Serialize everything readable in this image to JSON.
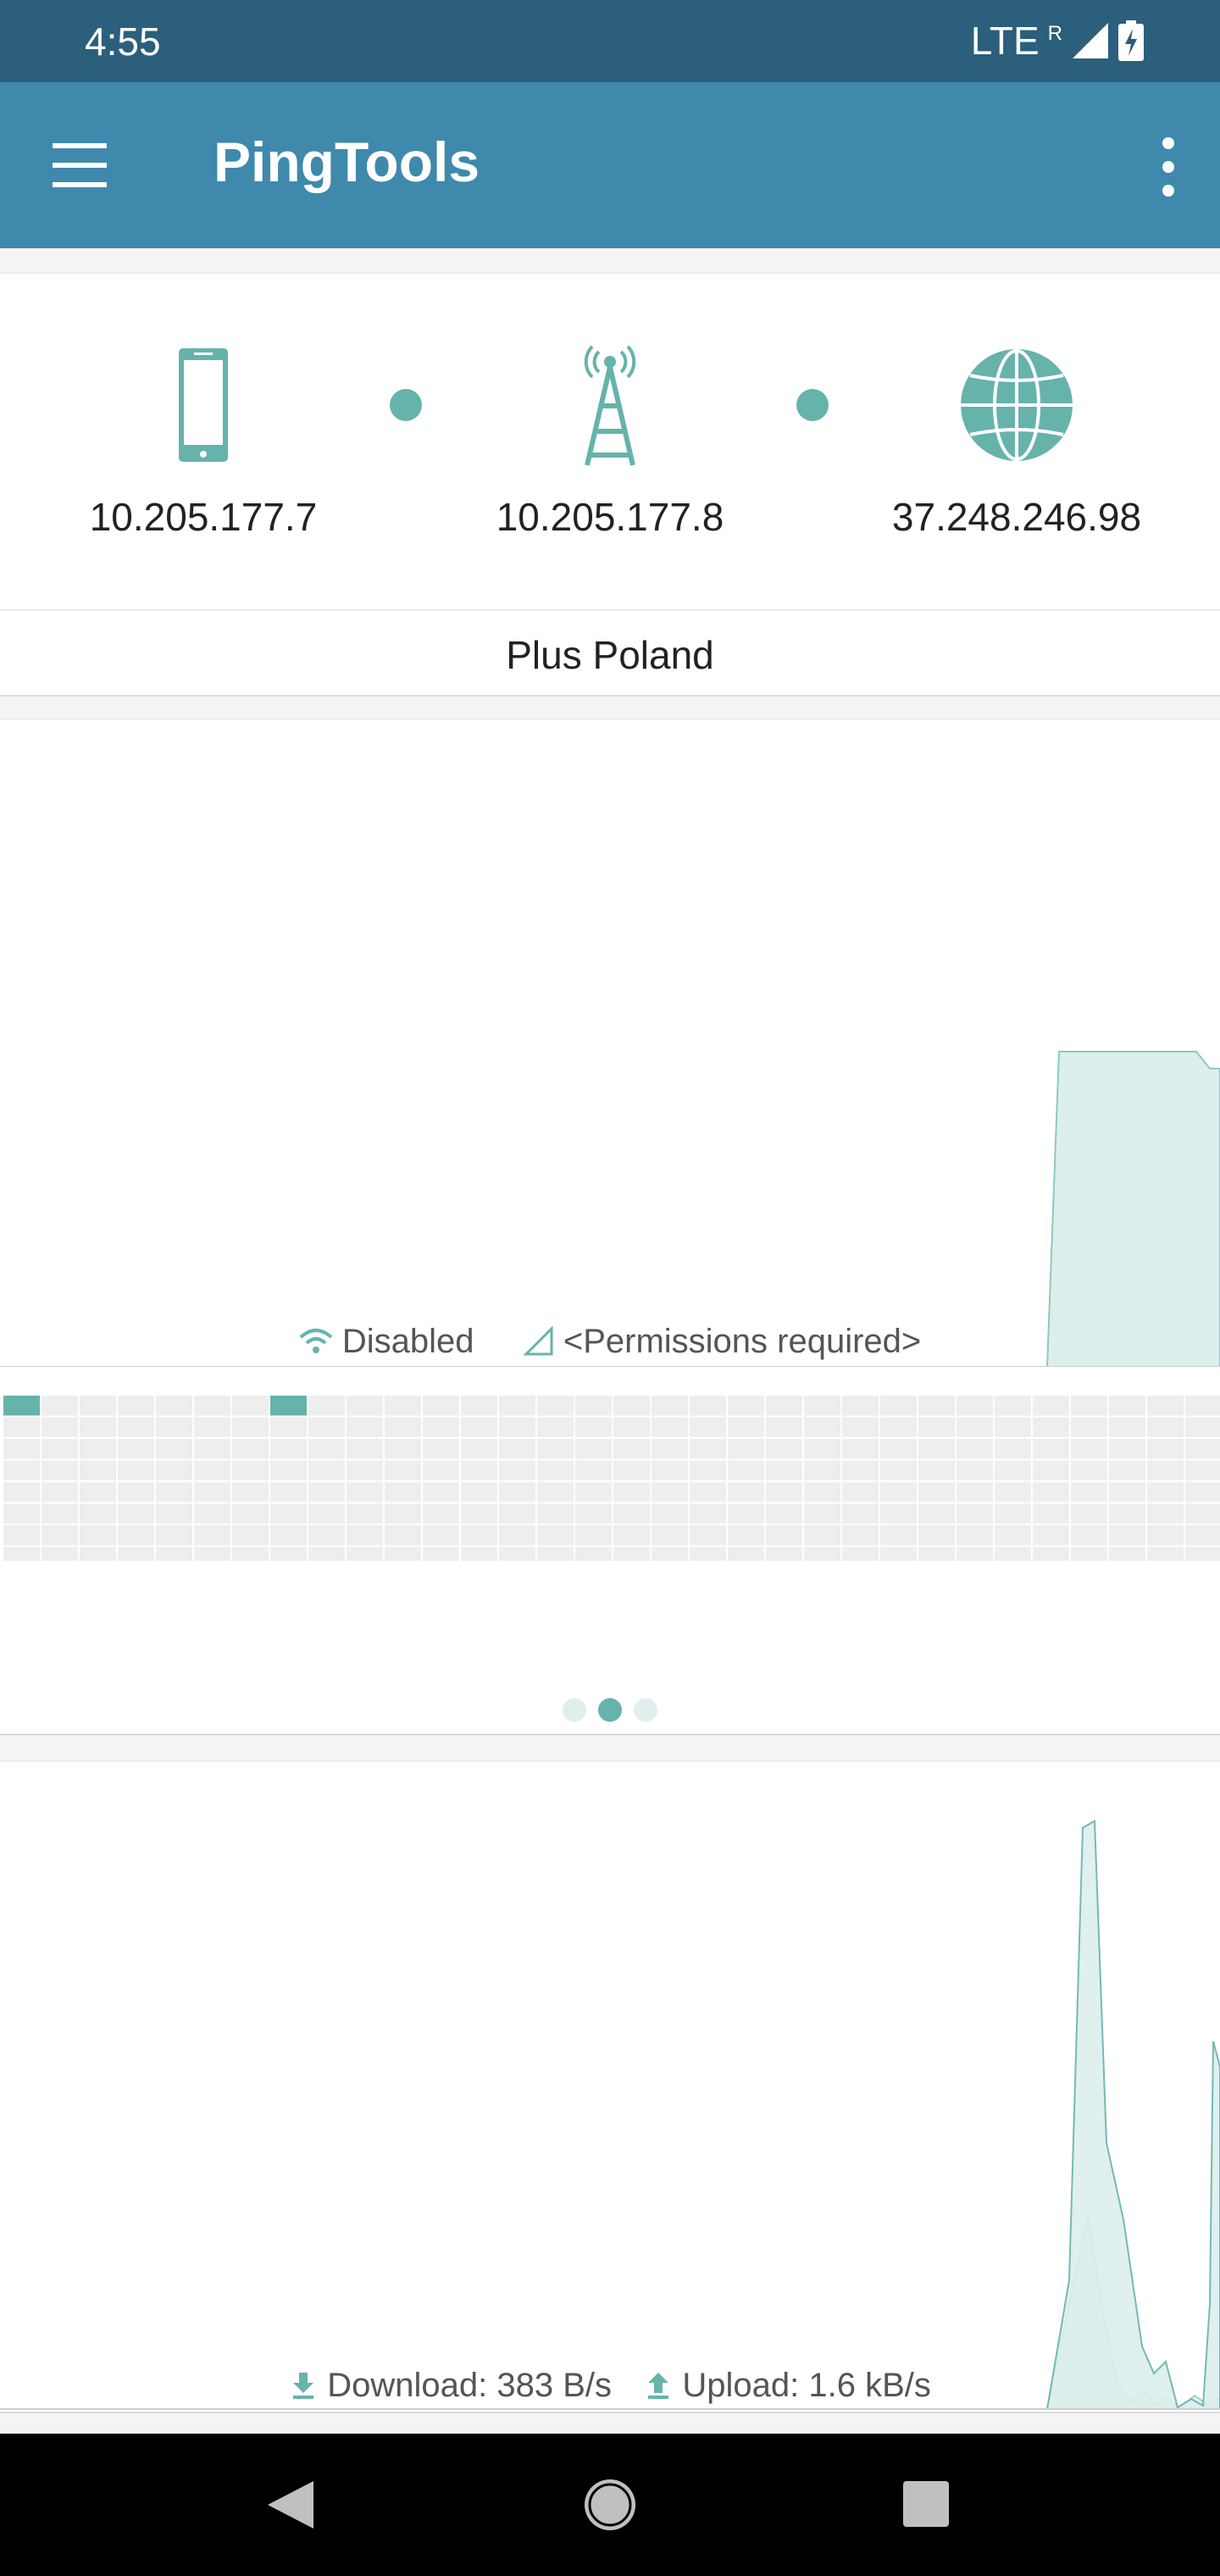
{
  "status_bar": {
    "time": "4:55",
    "network": "LTE",
    "roaming": "R"
  },
  "app_bar": {
    "title": "PingTools"
  },
  "route": {
    "nodes": [
      {
        "icon": "phone-icon",
        "ip": "10.205.177.7"
      },
      {
        "icon": "cell-tower-icon",
        "ip": "10.205.177.8"
      },
      {
        "icon": "globe-icon",
        "ip": "37.248.246.98"
      }
    ],
    "carrier": "Plus Poland"
  },
  "signal_panel": {
    "wifi_status": "Disabled",
    "cellular_status": "<Permissions required>",
    "active_cells": [
      [
        0,
        0
      ],
      [
        0,
        7
      ]
    ],
    "pager": {
      "pages": 3,
      "active": 1
    }
  },
  "traffic_panel": {
    "download_label": "Download: 383 B/s",
    "upload_label": "Upload: 1.6 kB/s"
  },
  "colors": {
    "accent": "#66b3ac",
    "app_bar": "#3f89ad",
    "status_bar": "#2b5f7b"
  }
}
